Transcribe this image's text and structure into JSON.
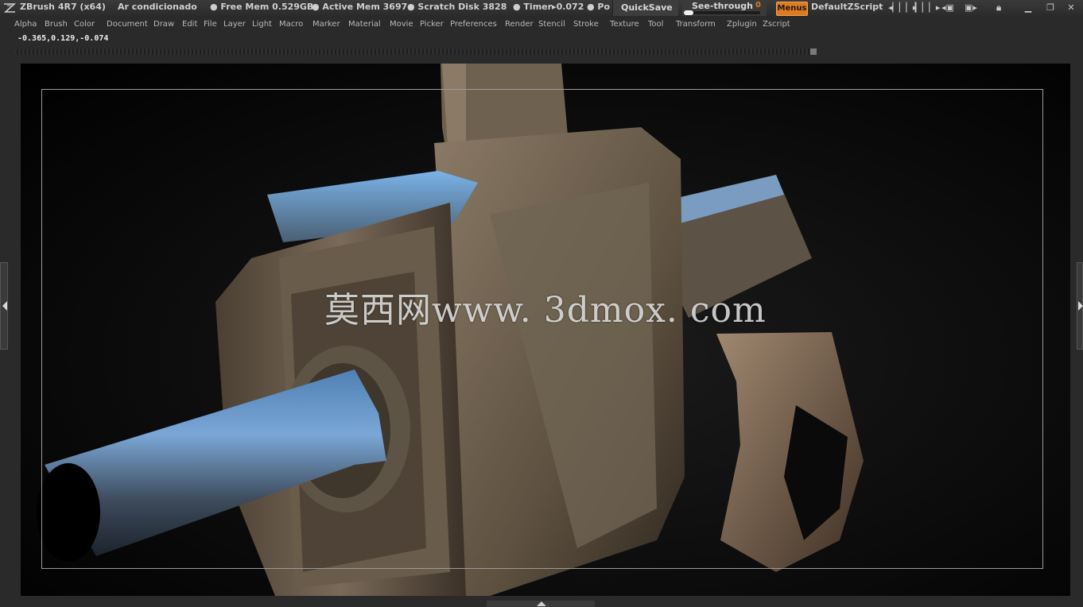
{
  "titlebar": {
    "app_title": "ZBrush 4R7 (x64)",
    "document_name": "Ar condicionado",
    "free_mem": "● Free Mem 0.529GB",
    "active_mem": "● Active Mem 3697",
    "scratch_disk": "● Scratch Disk 3828",
    "timer": "● Timer▸0.072",
    "poly_truncated": "● Po",
    "quicksave_label": "QuickSave",
    "see_through_label": "See-through",
    "see_through_value": "0",
    "menus_label": "Menus",
    "script_label": "DefaultZScript"
  },
  "menu": {
    "items": [
      "Alpha",
      "Brush",
      "Color",
      "Document",
      "Draw",
      "Edit",
      "File",
      "Layer",
      "Light",
      "Macro",
      "Marker",
      "Material",
      "Movie",
      "Picker",
      "Preferences",
      "Render",
      "Stencil",
      "Stroke",
      "Texture",
      "Tool",
      "Transform",
      "Zplugin",
      "Zscript"
    ]
  },
  "status": {
    "coord_a": "-0.365,0.129",
    "coord_b": ",-0.074"
  },
  "canvas": {
    "watermark": "莫西网www. 3dmox. com"
  },
  "colors": {
    "accent": "#e07a1f",
    "background": "#2a2a2a",
    "canvas": "#000000"
  }
}
